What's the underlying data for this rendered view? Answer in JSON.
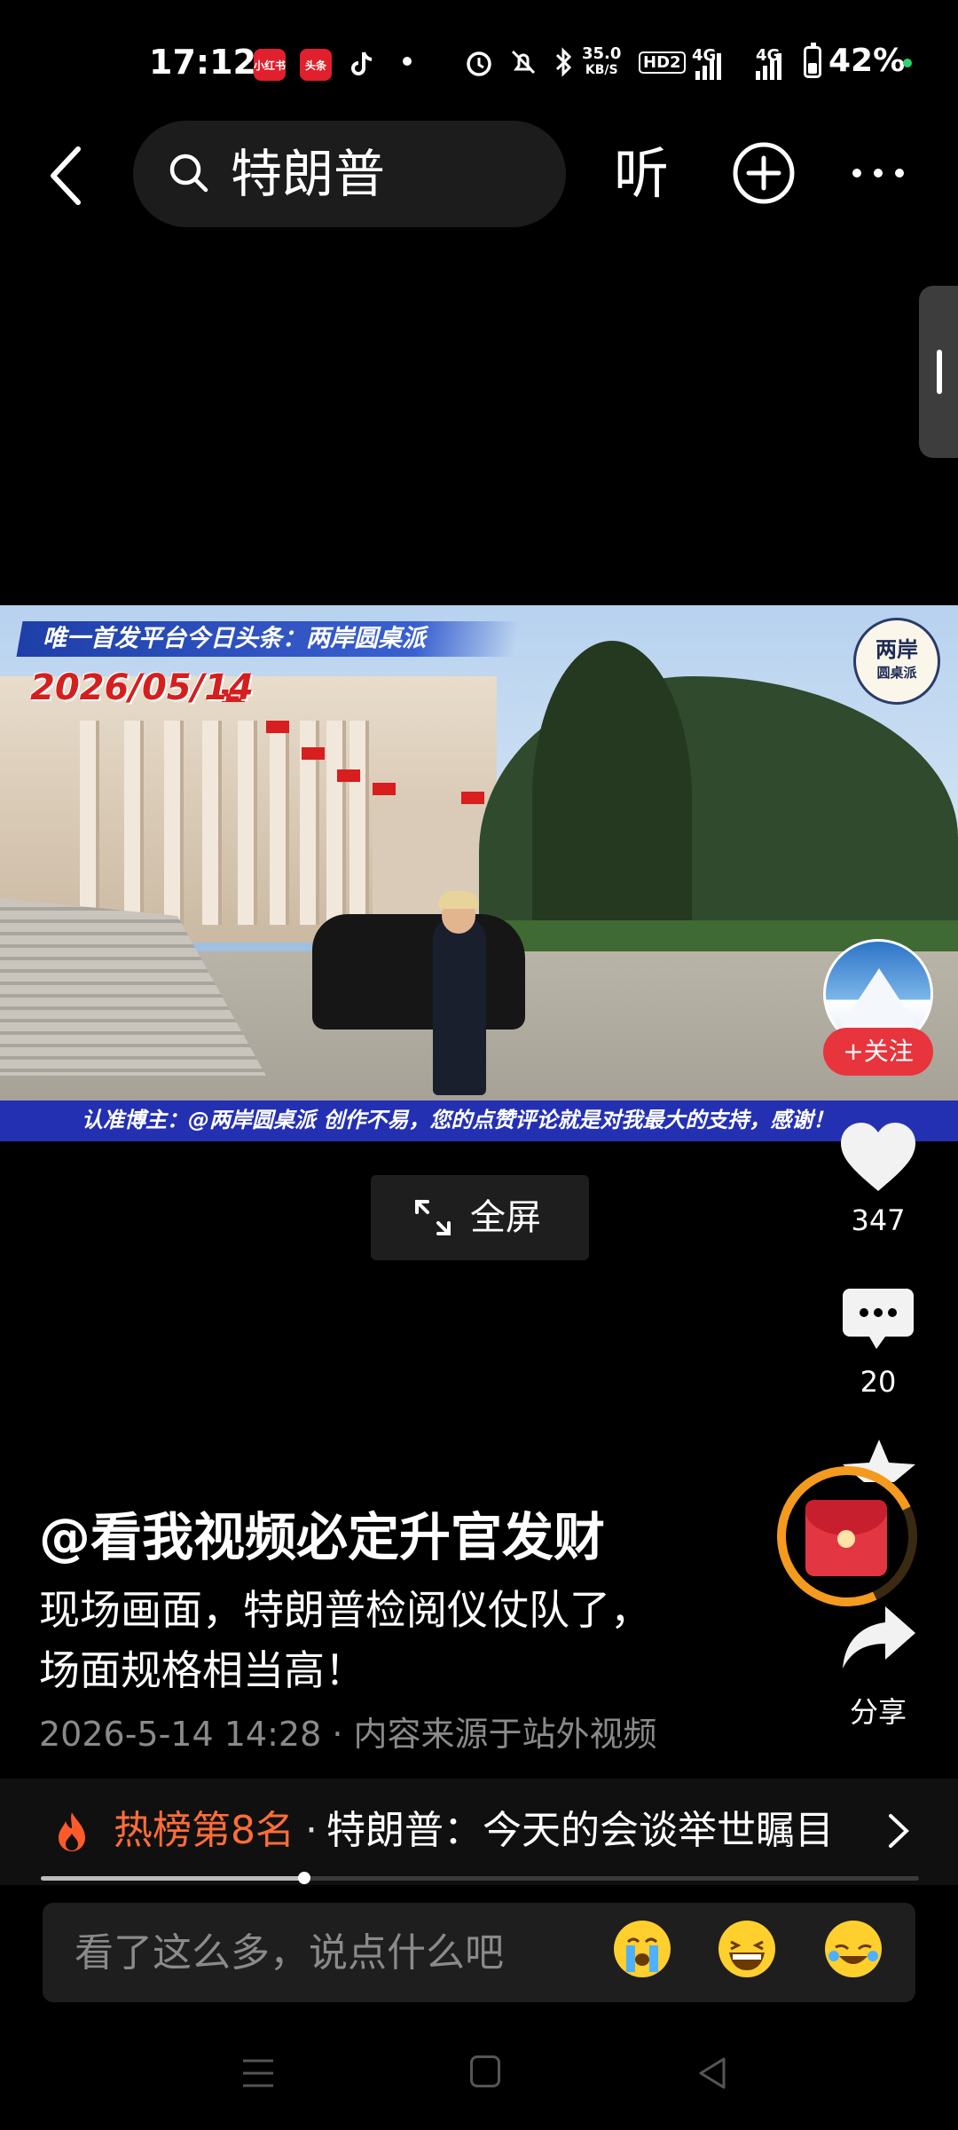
{
  "status_bar": {
    "time": "17:12",
    "app_badges": [
      "小红书",
      "头条",
      "抖音"
    ],
    "net_speed_top": "35.0",
    "net_speed_bottom": "KB/S",
    "hd_label": "HD2",
    "network_1": "4G",
    "network_2": "4G",
    "battery": "42%",
    "battery_level": 0.42,
    "icons": [
      "alarm-icon",
      "mute-icon",
      "bluetooth-icon"
    ]
  },
  "top_nav": {
    "search_query": "特朗普",
    "listen_label": "听"
  },
  "video": {
    "overlay_top": "唯一首发平台今日头条：两岸圆桌派",
    "overlay_date": "2026/05/14",
    "logo_line1": "两岸",
    "logo_line2": "圆桌派",
    "overlay_bottom": "认准博主：@两岸圆桌派 创作不易，您的点赞评论就是对我最大的支持，感谢！",
    "fullscreen_label": "全屏"
  },
  "actions": {
    "follow_label": "+关注",
    "likes": "347",
    "comments": "20",
    "share_label": "分享"
  },
  "post": {
    "author": "@看我视频必定升官发财",
    "description": "现场画面，特朗普检阅仪仗队了，\n场面规格相当高！",
    "meta": "2026-5-14 14:28 · 内容来源于站外视频"
  },
  "hot": {
    "rank_label": "热榜第8名",
    "separator": "·",
    "title": "特朗普：今天的会谈举世瞩目",
    "progress": 0.3
  },
  "comment": {
    "placeholder": "看了这么多，说点什么吧",
    "emojis": [
      "crying-emoji",
      "laughing-emoji",
      "rofl-emoji"
    ]
  },
  "colors": {
    "accent_red": "#e8343c",
    "hot_orange": "#ff6d38",
    "packet_ring": "#f39a1f"
  }
}
